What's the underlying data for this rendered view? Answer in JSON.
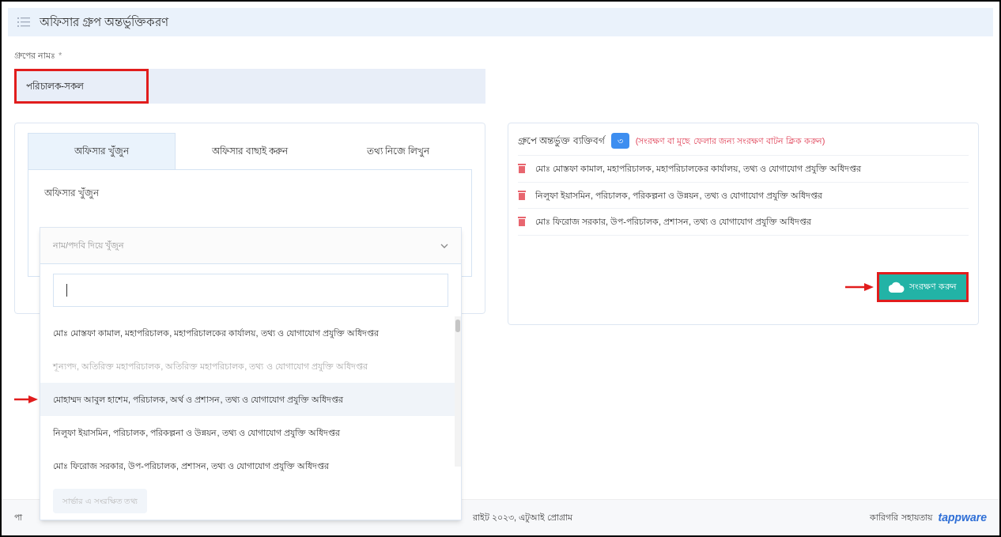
{
  "header": {
    "title": "অফিসার গ্রুপ অন্তর্ভুক্তিকরণ"
  },
  "group_name": {
    "label": "গ্রুপের নামঃ",
    "required_mark": "*",
    "value": "পরিচালক-সকল"
  },
  "tabs": [
    {
      "label": "অফিসার খুঁজুন",
      "selected": true
    },
    {
      "label": "অফিসার বাছাই করুন",
      "selected": false
    },
    {
      "label": "তথ্য নিজে লিখুন",
      "selected": false
    }
  ],
  "search": {
    "label": "অফিসার খুঁজুন",
    "placeholder": "নাম/পদবি দিয়ে খুঁজুন"
  },
  "dropdown": {
    "options": [
      {
        "text": "মোঃ মোস্তফা কামাল, মহাপরিচালক, মহাপরিচালকের কার্যালয়, তথ্য ও যোগাযোগ প্রযুক্তি অধিদপ্তর",
        "disabled": false,
        "highlighted": false,
        "annotated": false
      },
      {
        "text": "শূন্যপদ, অতিরিক্ত মহাপরিচালক, অতিরিক্ত মহাপরিচালক, তথ্য ও যোগাযোগ প্রযুক্তি অধিদপ্তর",
        "disabled": true,
        "highlighted": false,
        "annotated": false
      },
      {
        "text": "মোহাম্মদ আবুল হাশেম, পরিচালক, অর্থ ও প্রশাসন, তথ্য ও যোগাযোগ প্রযুক্তি অধিদপ্তর",
        "disabled": false,
        "highlighted": true,
        "annotated": true
      },
      {
        "text": "নিলুফা ইয়াসমিন, পরিচালক, পরিকল্পনা ও উন্নয়ন, তথ্য ও যোগাযোগ প্রযুক্তি অধিদপ্তর",
        "disabled": false,
        "highlighted": false,
        "annotated": false
      },
      {
        "text": "মোঃ ফিরোজ সরকার, উপ-পরিচালক, প্রশাসন, তথ্য ও যোগাযোগ প্রযুক্তি অধিদপ্তর",
        "disabled": false,
        "highlighted": false,
        "annotated": false
      }
    ],
    "footer_button": "সার্ভার এ সংরক্ষিত তথ্য"
  },
  "members": {
    "title": "গ্রুপে অন্তর্ভুক্ত ব্যক্তিবর্গ",
    "count": "৩",
    "note": "(সংরক্ষণ বা মুছে ফেলার জন্য সংরক্ষণ বাটন ক্লিক করুন)",
    "items": [
      "মোঃ মোস্তফা কামাল, মহাপরিচালক, মহাপরিচালকের কার্যালয়, তথ্য ও যোগাযোগ প্রযুক্তি অধিদপ্তর",
      "নিলুফা ইয়াসমিন, পরিচালক, পরিকল্পনা ও উন্নয়ন, তথ্য ও যোগাযোগ প্রযুক্তি অধিদপ্তর",
      "মোঃ ফিরোজ সরকার, উপ-পরিচালক, প্রশাসন, তথ্য ও যোগাযোগ প্রযুক্তি অধিদপ্তর"
    ]
  },
  "save_button": {
    "label": "সংরক্ষণ করুন"
  },
  "footer": {
    "left_fragment": "পা",
    "copyright": "রাইট ২০২৩, এটুআই প্রোগ্রাম",
    "support": "কারিগরি সহায়তায়",
    "brand": "tappware"
  }
}
